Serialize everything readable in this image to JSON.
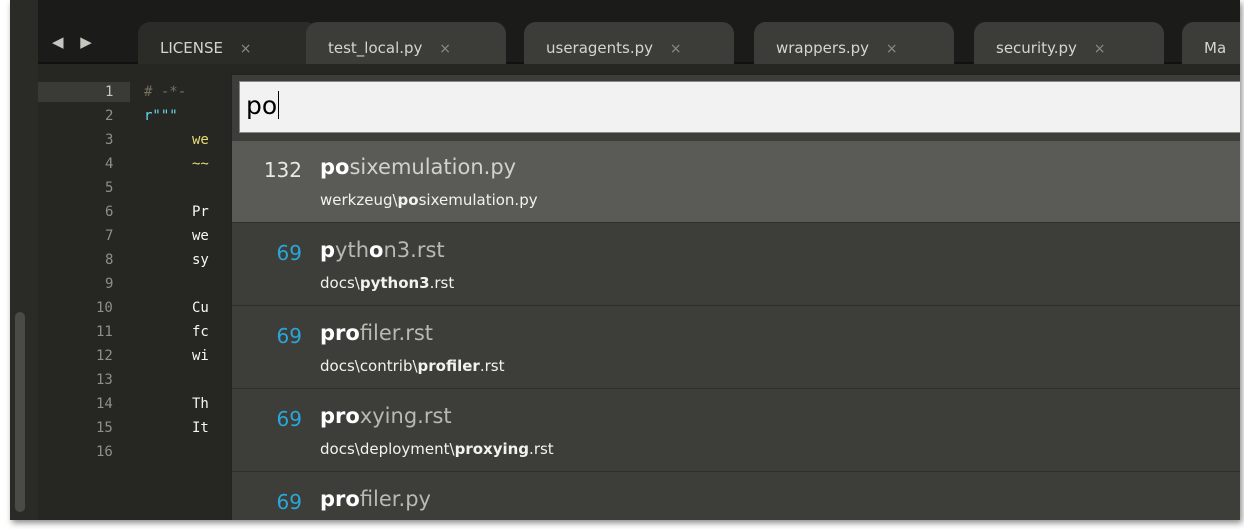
{
  "tabs": [
    {
      "label": "LICENSE",
      "close": "×"
    },
    {
      "label": "test_local.py",
      "close": "×"
    },
    {
      "label": "useragents.py",
      "close": "×"
    },
    {
      "label": "wrappers.py",
      "close": "×"
    },
    {
      "label": "security.py",
      "close": "×"
    },
    {
      "label": "Ma"
    }
  ],
  "nav": {
    "arrows": "◀ ▶"
  },
  "gutter": {
    "lines": [
      "1",
      "2",
      "3",
      "4",
      "5",
      "6",
      "7",
      "8",
      "9",
      "10",
      "11",
      "12",
      "13",
      "14",
      "15",
      "16"
    ]
  },
  "code": {
    "lines": [
      "# -*-",
      "r\"\"\"",
      "we",
      "~~",
      "",
      "Pr",
      "we",
      "sy",
      "",
      "Cu",
      "fc",
      "wi",
      "",
      "Th",
      "It",
      ""
    ]
  },
  "palette": {
    "query": "po",
    "results": [
      {
        "score": "132",
        "name_hl": "po",
        "name_rest": "sixemulation.py",
        "path_pre": "werkzeug\\",
        "path_hl": "po",
        "path_post": "sixemulation.py",
        "selected": true
      },
      {
        "score": "69",
        "name_parts": [
          [
            "p",
            true
          ],
          [
            "yth",
            false
          ],
          [
            "o",
            true
          ],
          [
            "n3.rst",
            false
          ]
        ],
        "path_pre": "docs\\",
        "path_hl": "python3",
        "path_post": ".rst"
      },
      {
        "score": "69",
        "name_parts": [
          [
            "pro",
            true
          ],
          [
            "filer.rst",
            false
          ]
        ],
        "path_pre": "docs\\contrib\\",
        "path_hl": "profiler",
        "path_post": ".rst"
      },
      {
        "score": "69",
        "name_parts": [
          [
            "pro",
            true
          ],
          [
            "xying.rst",
            false
          ]
        ],
        "path_pre": "docs\\deployment\\",
        "path_hl": "proxying",
        "path_post": ".rst"
      },
      {
        "score": "69",
        "name_parts": [
          [
            "pro",
            true
          ],
          [
            "filer.py",
            false
          ]
        ],
        "path_pre": "",
        "path_hl": "",
        "path_post": ""
      }
    ]
  },
  "colors": {
    "score": "#2aa7d9",
    "background": "#262723",
    "selected_row": "#5a5b56"
  }
}
